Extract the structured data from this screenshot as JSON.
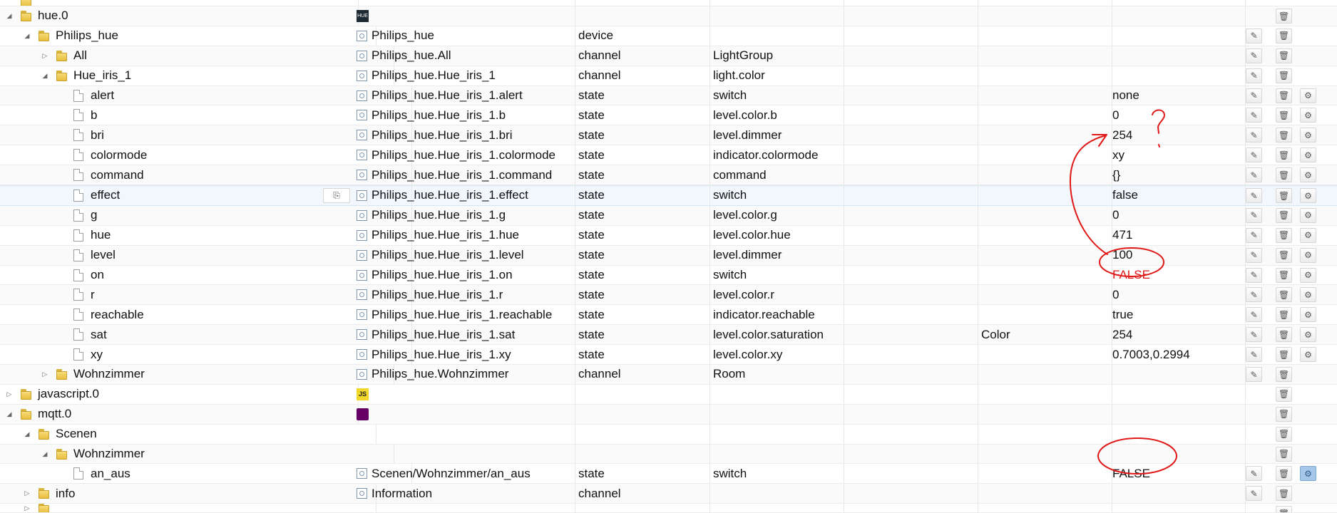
{
  "colors": {
    "annotation": "#e01818",
    "folder": "#e8bd3c",
    "selected_row": "#f1f7fc"
  },
  "rows": [
    {
      "level": 1,
      "kind": "folder",
      "toggle": "",
      "name": "",
      "id": "",
      "type": "",
      "role": "",
      "x": "",
      "room": "",
      "value": "",
      "buttons": [],
      "partial": true
    },
    {
      "level": 1,
      "kind": "folder",
      "toggle": "expanded",
      "name": "hue.0",
      "adapter": "hue",
      "id": "",
      "type": "",
      "role": "",
      "x": "",
      "room": "",
      "value": "",
      "buttons": [
        "delete"
      ]
    },
    {
      "level": 2,
      "kind": "folder",
      "toggle": "expanded",
      "name": "Philips_hue",
      "icon": true,
      "id": "Philips_hue",
      "type": "device",
      "role": "",
      "x": "",
      "room": "",
      "value": "",
      "buttons": [
        "edit",
        "delete"
      ]
    },
    {
      "level": 3,
      "kind": "folder",
      "toggle": "collapsed",
      "name": "All",
      "icon": true,
      "id": "Philips_hue.All",
      "type": "channel",
      "role": "LightGroup",
      "x": "",
      "room": "",
      "value": "",
      "buttons": [
        "edit",
        "delete"
      ]
    },
    {
      "level": 3,
      "kind": "folder",
      "toggle": "expanded",
      "name": "Hue_iris_1",
      "icon": true,
      "id": "Philips_hue.Hue_iris_1",
      "type": "channel",
      "role": "light.color",
      "x": "",
      "room": "",
      "value": "",
      "buttons": [
        "edit",
        "delete"
      ]
    },
    {
      "level": 4,
      "kind": "file",
      "name": "alert",
      "icon": true,
      "id": "Philips_hue.Hue_iris_1.alert",
      "type": "state",
      "role": "switch",
      "x": "",
      "room": "",
      "value": "none",
      "buttons": [
        "edit",
        "delete",
        "settings"
      ]
    },
    {
      "level": 4,
      "kind": "file",
      "name": "b",
      "icon": true,
      "id": "Philips_hue.Hue_iris_1.b",
      "type": "state",
      "role": "level.color.b",
      "x": "",
      "room": "",
      "value": "0",
      "buttons": [
        "edit",
        "delete",
        "settings"
      ]
    },
    {
      "level": 4,
      "kind": "file",
      "name": "bri",
      "icon": true,
      "id": "Philips_hue.Hue_iris_1.bri",
      "type": "state",
      "role": "level.dimmer",
      "x": "",
      "room": "",
      "value": "254",
      "buttons": [
        "edit",
        "delete",
        "settings"
      ]
    },
    {
      "level": 4,
      "kind": "file",
      "name": "colormode",
      "icon": true,
      "id": "Philips_hue.Hue_iris_1.colormode",
      "type": "state",
      "role": "indicator.colormode",
      "x": "",
      "room": "",
      "value": "xy",
      "buttons": [
        "edit",
        "delete",
        "settings"
      ]
    },
    {
      "level": 4,
      "kind": "file",
      "name": "command",
      "icon": true,
      "id": "Philips_hue.Hue_iris_1.command",
      "type": "state",
      "role": "command",
      "x": "",
      "room": "",
      "value": "{}",
      "buttons": [
        "edit",
        "delete",
        "settings"
      ]
    },
    {
      "level": 4,
      "kind": "file",
      "name": "effect",
      "icon": true,
      "id": "Philips_hue.Hue_iris_1.effect",
      "type": "state",
      "role": "switch",
      "x": "",
      "room": "",
      "value": "false",
      "buttons": [
        "edit",
        "delete",
        "settings"
      ],
      "selected": true
    },
    {
      "level": 4,
      "kind": "file",
      "name": "g",
      "icon": true,
      "id": "Philips_hue.Hue_iris_1.g",
      "type": "state",
      "role": "level.color.g",
      "x": "",
      "room": "",
      "value": "0",
      "buttons": [
        "edit",
        "delete",
        "settings"
      ]
    },
    {
      "level": 4,
      "kind": "file",
      "name": "hue",
      "icon": true,
      "id": "Philips_hue.Hue_iris_1.hue",
      "type": "state",
      "role": "level.color.hue",
      "x": "",
      "room": "",
      "value": "471",
      "buttons": [
        "edit",
        "delete",
        "settings"
      ]
    },
    {
      "level": 4,
      "kind": "file",
      "name": "level",
      "icon": true,
      "id": "Philips_hue.Hue_iris_1.level",
      "type": "state",
      "role": "level.dimmer",
      "x": "",
      "room": "",
      "value": "100",
      "buttons": [
        "edit",
        "delete",
        "settings"
      ]
    },
    {
      "level": 4,
      "kind": "file",
      "name": "on",
      "icon": true,
      "id": "Philips_hue.Hue_iris_1.on",
      "type": "state",
      "role": "switch",
      "x": "",
      "room": "",
      "value": "FALSE",
      "valueColor": "#e01818",
      "buttons": [
        "edit",
        "delete",
        "settings"
      ]
    },
    {
      "level": 4,
      "kind": "file",
      "name": "r",
      "icon": true,
      "id": "Philips_hue.Hue_iris_1.r",
      "type": "state",
      "role": "level.color.r",
      "x": "",
      "room": "",
      "value": "0",
      "buttons": [
        "edit",
        "delete",
        "settings"
      ]
    },
    {
      "level": 4,
      "kind": "file",
      "name": "reachable",
      "icon": true,
      "id": "Philips_hue.Hue_iris_1.reachable",
      "type": "state",
      "role": "indicator.reachable",
      "x": "",
      "room": "",
      "value": "true",
      "buttons": [
        "edit",
        "delete",
        "settings"
      ]
    },
    {
      "level": 4,
      "kind": "file",
      "name": "sat",
      "icon": true,
      "id": "Philips_hue.Hue_iris_1.sat",
      "type": "state",
      "role": "level.color.saturation",
      "x": "",
      "room": "Color",
      "value": "254",
      "buttons": [
        "edit",
        "delete",
        "settings"
      ]
    },
    {
      "level": 4,
      "kind": "file",
      "name": "xy",
      "icon": true,
      "id": "Philips_hue.Hue_iris_1.xy",
      "type": "state",
      "role": "level.color.xy",
      "x": "",
      "room": "",
      "value": "0.7003,0.2994",
      "buttons": [
        "edit",
        "delete",
        "settings"
      ]
    },
    {
      "level": 3,
      "kind": "folder",
      "toggle": "collapsed",
      "name": "Wohnzimmer",
      "icon": true,
      "id": "Philips_hue.Wohnzimmer",
      "type": "channel",
      "role": "Room",
      "x": "",
      "room": "",
      "value": "",
      "buttons": [
        "edit",
        "delete"
      ]
    },
    {
      "level": 1,
      "kind": "folder",
      "toggle": "collapsed",
      "name": "javascript.0",
      "adapter": "js",
      "id": "",
      "type": "",
      "role": "",
      "x": "",
      "room": "",
      "value": "",
      "buttons": [
        "delete"
      ]
    },
    {
      "level": 1,
      "kind": "folder",
      "toggle": "expanded",
      "name": "mqtt.0",
      "adapter": "mqtt",
      "id": "",
      "type": "",
      "role": "",
      "x": "",
      "room": "",
      "value": "",
      "buttons": [
        "delete"
      ]
    },
    {
      "level": 2,
      "kind": "folder",
      "toggle": "expanded",
      "name": "Scenen",
      "id": "",
      "type": "",
      "role": "",
      "x": "",
      "room": "",
      "value": "",
      "buttons": [
        "delete"
      ]
    },
    {
      "level": 3,
      "kind": "folder",
      "toggle": "expanded",
      "name": "Wohnzimmer",
      "id": "",
      "type": "",
      "role": "",
      "x": "",
      "room": "",
      "value": "",
      "buttons": [
        "delete"
      ]
    },
    {
      "level": 4,
      "kind": "file",
      "name": "an_aus",
      "icon": true,
      "id": "Scenen/Wohnzimmer/an_aus",
      "type": "state",
      "role": "switch",
      "x": "",
      "room": "",
      "value": "FALSE",
      "buttons": [
        "edit",
        "delete",
        "settings-active"
      ]
    },
    {
      "level": 2,
      "kind": "folder",
      "toggle": "collapsed",
      "name": "info",
      "icon": true,
      "id": "Information",
      "type": "channel",
      "role": "",
      "x": "",
      "room": "",
      "value": "",
      "buttons": [
        "edit",
        "delete"
      ]
    },
    {
      "level": 2,
      "kind": "folder",
      "toggle": "collapsed",
      "name": "",
      "id": "",
      "type": "",
      "role": "",
      "x": "",
      "room": "",
      "value": "",
      "buttons": [
        "delete"
      ],
      "partial": true
    }
  ]
}
